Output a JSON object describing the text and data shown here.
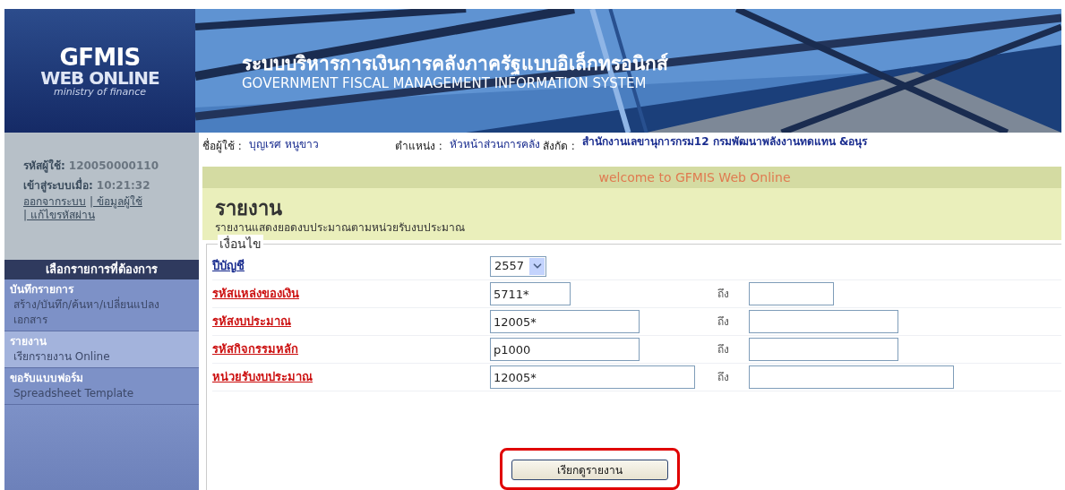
{
  "header": {
    "logo": {
      "line1": "GFMIS",
      "line2": "WEB ONLINE",
      "line3": "ministry of finance"
    },
    "title_th": "ระบบบริหารการเงินการคลังภาครัฐแบบอิเล็กทรอนิกส์",
    "title_en": "GOVERNMENT FISCAL MANAGEMENT INFORMATION SYSTEM"
  },
  "sidebar": {
    "user_id_label": "รหัสผู้ใช้:",
    "user_id": "120050000110",
    "login_label": "เข้าสู่ระบบเมื่อ:",
    "login_time": "10:21:32",
    "links": [
      "ออกจากระบบ",
      "| ข้อมูลผู้ใช้",
      "| แก้ไขรหัสผ่าน"
    ],
    "menu_title": "เลือกรายการที่ต้องการ",
    "items": [
      {
        "title": "บันทึกรายการ",
        "subtitle": "สร้าง/บันทึก/ค้นหา/เปลี่ยนแปลง เอกสาร",
        "selected": false
      },
      {
        "title": "รายงาน",
        "subtitle": "เรียกรายงาน Online",
        "selected": true
      },
      {
        "title": "ขอรับแบบฟอร์ม",
        "subtitle": "Spreadsheet Template",
        "selected": false
      }
    ]
  },
  "info_bar": [
    {
      "label": "ชื่อผู้ใช้ :",
      "value": "บุญเรศ หนูขาว"
    },
    {
      "label": "ตำแหน่ง :",
      "value": "หัวหน้าส่วนการคลัง"
    },
    {
      "label": "สังกัด :",
      "value": "สำนักงานเลขานุการกรม12 กรมพัฒนาพลังงานทดแทน &อนุร"
    }
  ],
  "welcome": "welcome to GFMIS Web Online",
  "page_title": "รายงาน",
  "page_subtitle": "รายงานแสดงยอดงบประมาณตามหน่วยรับงบประมาณ",
  "conditions": {
    "legend": "เงื่อนไข",
    "rows": [
      {
        "kind": "select",
        "label": "ปีบัญชี",
        "value": "2557"
      },
      {
        "kind": "range",
        "label": "รหัสแหล่งของเงิน",
        "value": "5711*",
        "to_label": "ถึง"
      },
      {
        "kind": "range",
        "label": "รหัสงบประมาณ",
        "value": "12005*",
        "to_label": "ถึง"
      },
      {
        "kind": "range",
        "label": "รหัสกิจกรรมหลัก",
        "value": "p1000",
        "to_label": "ถึง"
      },
      {
        "kind": "range",
        "label": "หน่วยรับงบประมาณ",
        "value": "12005*",
        "to_label": "ถึง"
      }
    ]
  },
  "submit_button": {
    "label": "เรียกดูรายงาน",
    "highlighted": true
  }
}
